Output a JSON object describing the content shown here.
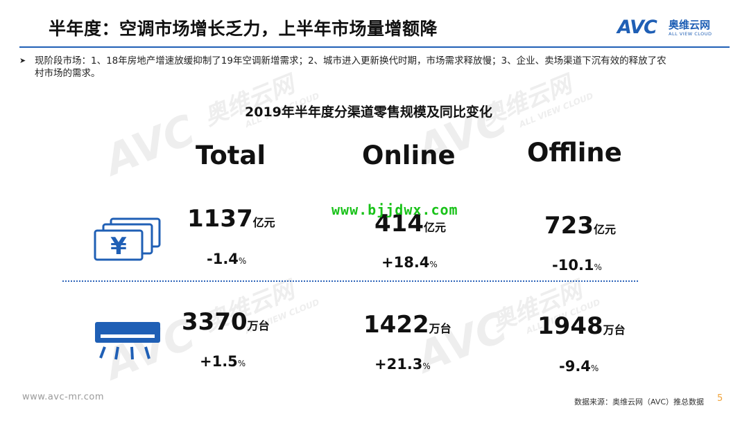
{
  "header": {
    "title": "半年度：空调市场增长乏力，上半年市场量增额降",
    "logo_mark": "AVC",
    "logo_cn": "奥维云网",
    "logo_en": "ALL VIEW CLOUD"
  },
  "bullet": {
    "mark": "➤",
    "text": "现阶段市场：1、18年房地产增速放缓抑制了19年空调新增需求；2、城市进入更新换代时期，市场需求释放慢；3、企业、卖场渠道下沉有效的释放了农村市场的需求。"
  },
  "chart_title": "2019年半年度分渠道零售规模及同比变化",
  "columns": [
    {
      "head": "Total"
    },
    {
      "head": "Online"
    },
    {
      "head": "Offline"
    }
  ],
  "revenue": {
    "icon": "money-icon",
    "unit": "亿元",
    "values": [
      "1137",
      "414",
      "723"
    ],
    "changes": [
      "-1.4",
      "+18.4",
      "-10.1"
    ]
  },
  "volume": {
    "icon": "air-conditioner-icon",
    "unit": "万台",
    "values": [
      "3370",
      "1422",
      "1948"
    ],
    "changes": [
      "+1.5",
      "+21.3",
      "-9.4"
    ]
  },
  "pct_sign": "%",
  "overlay_url": "www.bjjdwx.com",
  "watermark": {
    "cn": "奥维云网",
    "en": "ALL VIEW CLOUD"
  },
  "footer": {
    "url": "www.avc-mr.com",
    "source": "数据来源：奥维云网（AVC）推总数据",
    "page": "5"
  },
  "colors": {
    "brand_blue": "#1f5fb5",
    "overlay_green": "#19c219",
    "page_num": "#f0a33a"
  }
}
